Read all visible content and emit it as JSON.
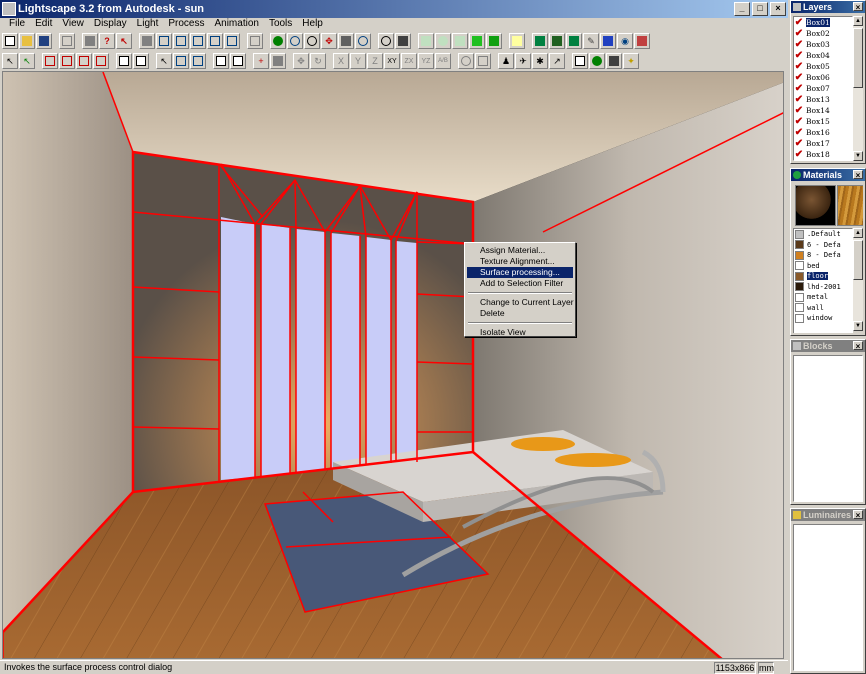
{
  "window": {
    "title": "Lightscape 3.2 from Autodesk - sun",
    "min": "_",
    "max": "□",
    "close": "×"
  },
  "menu": [
    "File",
    "Edit",
    "View",
    "Display",
    "Light",
    "Process",
    "Animation",
    "Tools",
    "Help"
  ],
  "toolbar2_text": {
    "x": "X",
    "y": "Y",
    "z": "Z",
    "xy": "XY",
    "zx": "ZX",
    "yz": "YZ",
    "abc": "A/B"
  },
  "context_menu": {
    "items": [
      {
        "label": "Assign Material...",
        "active": false
      },
      {
        "label": "Texture Alignment...",
        "active": false
      },
      {
        "label": "Surface processing...",
        "active": true
      },
      {
        "label": "Add to Selection Filter",
        "active": false
      },
      {
        "label": "Change to Current Layer",
        "active": false
      },
      {
        "label": "Delete",
        "active": false
      },
      {
        "label": "Isolate View",
        "active": false
      }
    ]
  },
  "status": {
    "text": "Invokes the surface process control dialog",
    "resolution": "1153x866",
    "unit": "mm"
  },
  "layers": {
    "title": "Layers",
    "close": "×",
    "items": [
      "Box01",
      "Box02",
      "Box03",
      "Box04",
      "Box05",
      "Box06",
      "Box07",
      "Box13",
      "Box14",
      "Box15",
      "Box16",
      "Box17",
      "Box18"
    ],
    "selected": "Box01"
  },
  "materials": {
    "title": "Materials",
    "close": "×",
    "items": [
      {
        "name": ".Default",
        "color": "#c0c0c0"
      },
      {
        "name": "6 - Defa",
        "color": "#5a3a1a"
      },
      {
        "name": "8 - Defa",
        "color": "#d08020"
      },
      {
        "name": "bed",
        "color": "#ffffff"
      },
      {
        "name": "floor",
        "color": "#8a5a2a",
        "selected": true
      },
      {
        "name": "lhd-2001",
        "color": "#2a1a0a"
      },
      {
        "name": "metal",
        "color": "#ffffff"
      },
      {
        "name": "wall",
        "color": "#ffffff"
      },
      {
        "name": "window",
        "color": "#ffffff"
      }
    ]
  },
  "blocks": {
    "title": "Blocks",
    "close": "×"
  },
  "luminaires": {
    "title": "Luminaires",
    "close": "×"
  }
}
